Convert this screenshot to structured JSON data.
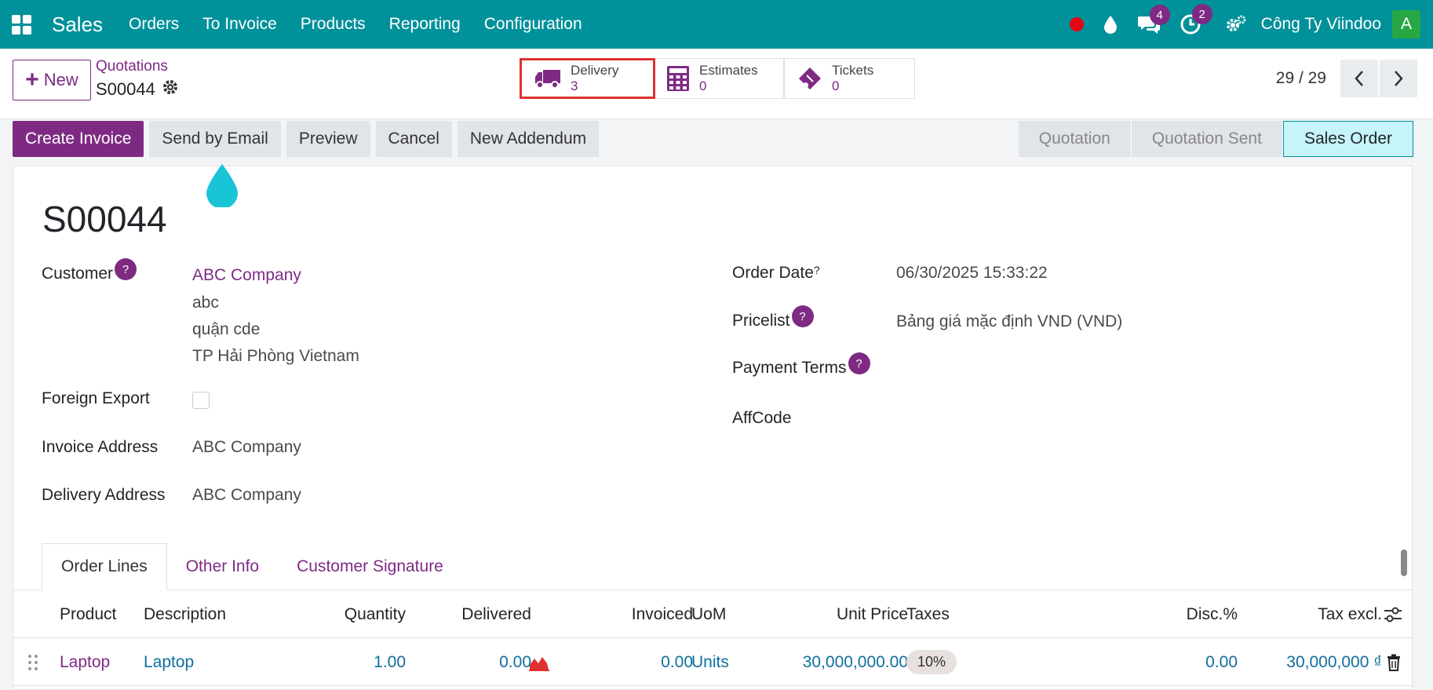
{
  "navbar": {
    "app_name": "Sales",
    "menu": [
      "Orders",
      "To Invoice",
      "Products",
      "Reporting",
      "Configuration"
    ],
    "messages_count": "4",
    "activities_count": "2",
    "company": "Công Ty Viindoo",
    "avatar_initial": "A"
  },
  "control": {
    "new_label": "New",
    "breadcrumb_parent": "Quotations",
    "breadcrumb_current": "S00044",
    "smart_buttons": [
      {
        "label": "Delivery",
        "count": "3"
      },
      {
        "label": "Estimates",
        "count": "0"
      },
      {
        "label": "Tickets",
        "count": "0"
      }
    ],
    "pager": "29 / 29"
  },
  "actions": [
    "Create Invoice",
    "Send by Email",
    "Preview",
    "Cancel",
    "New Addendum"
  ],
  "status_stages": [
    "Quotation",
    "Quotation Sent",
    "Sales Order"
  ],
  "active_stage": "Sales Order",
  "form": {
    "name": "S00044",
    "customer_label": "Customer",
    "customer_name": "ABC Company",
    "customer_address": [
      "abc",
      "quận cde",
      "TP Hải Phòng Vietnam"
    ],
    "foreign_export_label": "Foreign Export",
    "invoice_address_label": "Invoice Address",
    "invoice_address": "ABC Company",
    "delivery_address_label": "Delivery Address",
    "delivery_address": "ABC Company",
    "order_date_label": "Order Date",
    "order_date": "06/30/2025 15:33:22",
    "pricelist_label": "Pricelist",
    "pricelist": "Bảng giá mặc định VND (VND)",
    "payment_terms_label": "Payment Terms",
    "affcode_label": "AffCode",
    "help_mark": "?"
  },
  "tabs": [
    "Order Lines",
    "Other Info",
    "Customer Signature"
  ],
  "table": {
    "columns": [
      "Product",
      "Description",
      "Quantity",
      "Delivered",
      "Invoiced",
      "UoM",
      "Unit Price",
      "Taxes",
      "Disc.%",
      "Tax excl."
    ],
    "rows": [
      {
        "product": "Laptop",
        "description": "Laptop",
        "quantity": "1.00",
        "delivered": "0.00",
        "invoiced": "0.00",
        "uom": "Units",
        "unit_price": "30,000,000.00",
        "taxes": "10%",
        "discount": "0.00",
        "tax_excl": "30,000,000 ₫"
      }
    ]
  },
  "colors": {
    "navbar": "#01919a",
    "primary": "#7e2a83",
    "highlight_border": "#e03131"
  }
}
